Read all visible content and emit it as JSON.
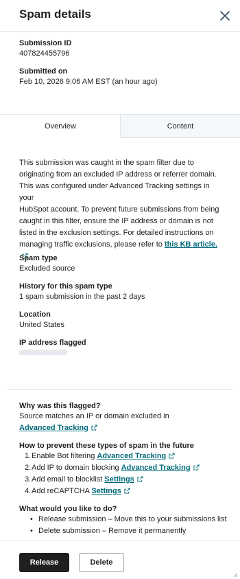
{
  "header": {
    "title": "Spam details"
  },
  "meta": {
    "submission_id_label": "Submission ID",
    "submission_id": "407824455796",
    "submitted_on_label": "Submitted on",
    "submitted_on": "Feb 10, 2026 9:06 AM EST (an hour ago)"
  },
  "tabs": [
    {
      "label": "Overview",
      "active": true
    },
    {
      "label": "Content",
      "active": false
    }
  ],
  "overview": {
    "description_lines": [
      "This submission was caught in the spam filter due to",
      "originating from an excluded IP address or referrer domain.",
      "This was configured under Advanced Tracking settings in your",
      "HubSpot account. To prevent future submissions from being",
      "caught in this filter, ensure the IP address or domain is not",
      "listed in the exclusion settings. For detailed instructions on",
      "managing traffic exclusions, please refer to"
    ],
    "kb_link": "this KB article.",
    "fields": [
      {
        "label": "Spam type",
        "value": "Excluded source"
      },
      {
        "label": "History for this spam type",
        "value": "1 spam submission in the past 2 days"
      },
      {
        "label": "Location",
        "value": "United States"
      },
      {
        "label": "IP address flagged",
        "value": ""
      }
    ]
  },
  "why": {
    "title": "Why was this flagged?",
    "text": "Source matches an IP or domain excluded in",
    "link": "Advanced Tracking"
  },
  "prevent": {
    "title": "How to prevent these types of spam in the future",
    "steps": [
      {
        "num": "1.",
        "text": "Enable Bot filtering",
        "link": "Advanced Tracking"
      },
      {
        "num": "2.",
        "text": "Add IP to domain blocking",
        "link": "Advanced Tracking"
      },
      {
        "num": "3.",
        "text": "Add email to blocklist",
        "link": "Settings"
      },
      {
        "num": "4.",
        "text": "Add reCAPTCHA",
        "link": "Settings"
      }
    ]
  },
  "actions_info": {
    "title": "What would you like to do?",
    "items": [
      "Release submission – Move this to your submissions list",
      "Delete submission – Remove it permanently"
    ]
  },
  "footer": {
    "release_label": "Release",
    "delete_label": "Delete"
  },
  "colors": {
    "link": "#006a7a",
    "primary_button": "#1f1f1f",
    "border": "#dfe3eb",
    "tab_inactive_bg": "#f5f8fa"
  },
  "icons": {
    "close": "close-icon",
    "external": "external-link-icon",
    "resize": "resize-grip-icon"
  }
}
